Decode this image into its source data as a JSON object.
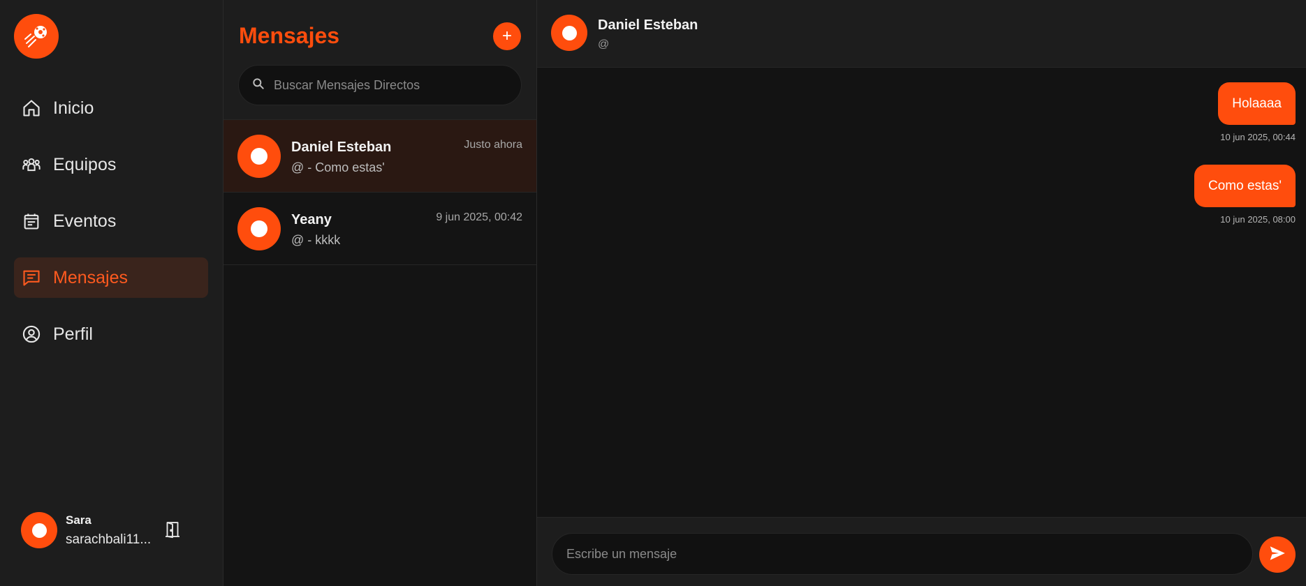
{
  "sidebar": {
    "logo_icon": "soccer-ball-logo-icon",
    "items": [
      {
        "label": "Inicio",
        "icon": "home-icon",
        "active": false
      },
      {
        "label": "Equipos",
        "icon": "teams-icon",
        "active": false
      },
      {
        "label": "Eventos",
        "icon": "calendar-icon",
        "active": false
      },
      {
        "label": "Mensajes",
        "icon": "message-icon",
        "active": true
      },
      {
        "label": "Perfil",
        "icon": "profile-icon",
        "active": false
      }
    ],
    "user": {
      "name": "Sara",
      "handle": "sarachbali11..."
    },
    "logout_icon": "door-logout-icon"
  },
  "conversations": {
    "title": "Mensajes",
    "new_button": "+",
    "search_placeholder": "Buscar Mensajes Directos",
    "items": [
      {
        "name": "Daniel Esteban",
        "subtitle": "@ - Como estas'",
        "time": "Justo ahora",
        "active": true
      },
      {
        "name": "Yeany",
        "subtitle": "@ - kkkk",
        "time": "9 jun 2025, 00:42",
        "active": false
      }
    ]
  },
  "chat": {
    "name": "Daniel Esteban",
    "handle": "@",
    "messages": [
      {
        "text": "Holaaaa",
        "time": "10 jun 2025, 00:44"
      },
      {
        "text": "Como estas'",
        "time": "10 jun 2025, 08:00"
      }
    ],
    "input_placeholder": "Escribe un mensaje",
    "send_icon": "send-icon"
  },
  "colors": {
    "accent": "#ff4d0d",
    "active_bg": "#3a241c",
    "panel": "#1d1d1d",
    "background": "#131313"
  }
}
